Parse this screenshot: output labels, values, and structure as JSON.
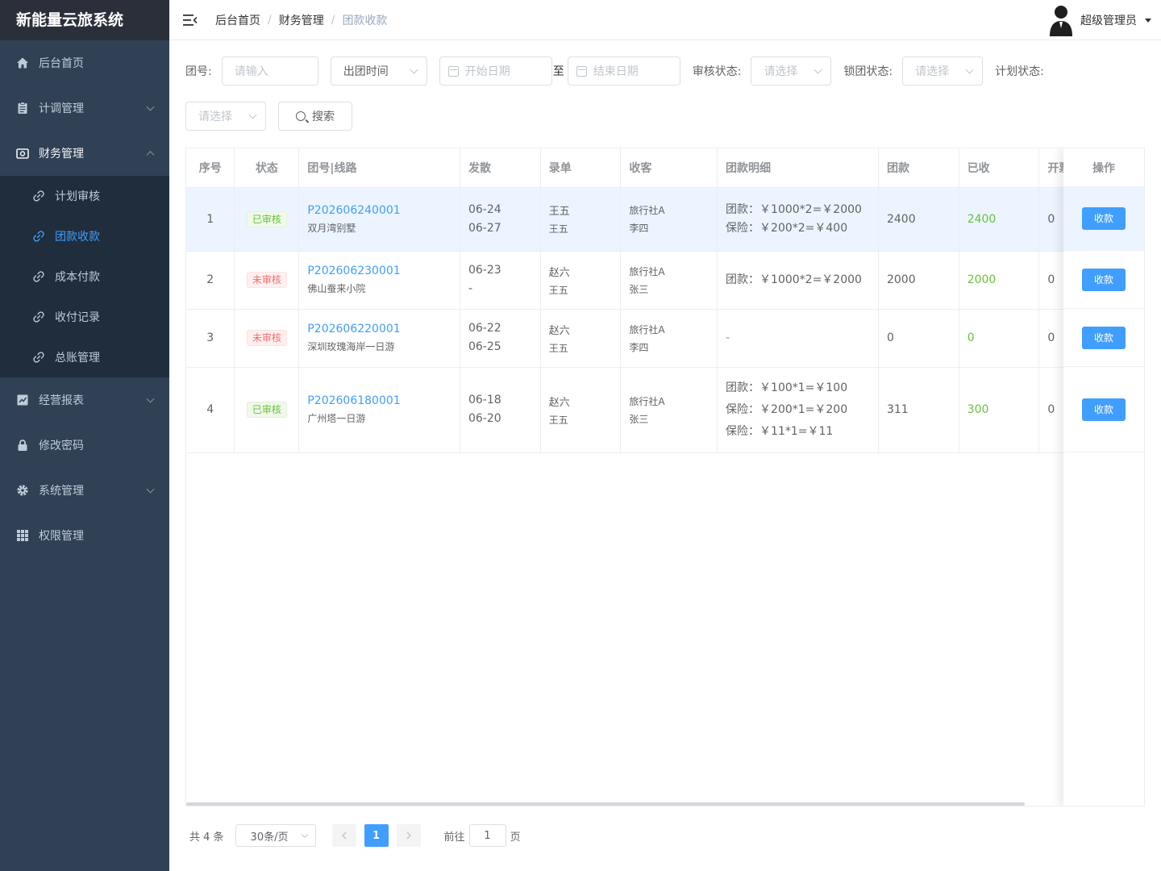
{
  "app": {
    "title": "新能量云旅系统"
  },
  "sidebar": {
    "items": [
      {
        "label": "后台首页",
        "icon": "home-icon"
      },
      {
        "label": "计调管理",
        "icon": "clipboard-icon"
      },
      {
        "label": "财务管理",
        "icon": "wallet-icon"
      },
      {
        "label": "经营报表",
        "icon": "chart-icon"
      },
      {
        "label": "修改密码",
        "icon": "lock-icon"
      },
      {
        "label": "系统管理",
        "icon": "gear-icon"
      },
      {
        "label": "权限管理",
        "icon": "grid-icon"
      }
    ],
    "finance_sub": [
      {
        "label": "计划审核"
      },
      {
        "label": "团款收款"
      },
      {
        "label": "成本付款"
      },
      {
        "label": "收付记录"
      },
      {
        "label": "总账管理"
      }
    ]
  },
  "header": {
    "breadcrumb": [
      "后台首页",
      "财务管理",
      "团款收款"
    ],
    "user_name": "超级管理员"
  },
  "filters": {
    "group_no_label": "团号:",
    "group_no_placeholder": "请输入",
    "date_type": "出团时间",
    "start_placeholder": "开始日期",
    "range_sep": "至",
    "end_placeholder": "结束日期",
    "audit_label": "审核状态:",
    "audit_placeholder": "请选择",
    "lock_label": "锁团状态:",
    "lock_placeholder": "请选择",
    "plan_label": "计划状态:",
    "plan_placeholder": "请选择",
    "search_label": "搜索"
  },
  "table": {
    "headers": [
      "序号",
      "状态",
      "团号|线路",
      "发散",
      "录单",
      "收客",
      "团款明细",
      "团款",
      "已收",
      "开票"
    ],
    "op_header": "操作",
    "op_button": "收款",
    "rows": [
      {
        "no": "1",
        "status": "已审核",
        "status_ok": true,
        "group_no": "P202606240001",
        "route": "双月湾别墅",
        "date1": "06-24",
        "date2": "06-27",
        "entry1": "王五",
        "entry2": "王五",
        "client1": "旅行社A",
        "client2": "李四",
        "details": [
          "团款：￥1000*2=￥2000",
          "保险：￥200*2=￥400"
        ],
        "amount": "2400",
        "received": "2400",
        "invoice": "0"
      },
      {
        "no": "2",
        "status": "未审核",
        "status_ok": false,
        "group_no": "P202606230001",
        "route": "佛山蚕来小院",
        "date1": "06-23",
        "date2": "-",
        "entry1": "赵六",
        "entry2": "王五",
        "client1": "旅行社A",
        "client2": "张三",
        "details": [
          "团款：￥1000*2=￥2000"
        ],
        "amount": "2000",
        "received": "2000",
        "invoice": "0"
      },
      {
        "no": "3",
        "status": "未审核",
        "status_ok": false,
        "group_no": "P202606220001",
        "route": "深圳玫瑰海岸一日游",
        "date1": "06-22",
        "date2": "06-25",
        "entry1": "赵六",
        "entry2": "王五",
        "client1": "旅行社A",
        "client2": "李四",
        "details": [
          "-"
        ],
        "amount": "0",
        "received": "0",
        "invoice": "0"
      },
      {
        "no": "4",
        "status": "已审核",
        "status_ok": true,
        "group_no": "P202606180001",
        "route": "广州塔一日游",
        "date1": "06-18",
        "date2": "06-20",
        "entry1": "赵六",
        "entry2": "王五",
        "client1": "旅行社A",
        "client2": "张三",
        "details": [
          "团款：￥100*1=￥100",
          "保险：￥200*1=￥200",
          "保险：￥11*1=￥11"
        ],
        "amount": "311",
        "received": "300",
        "invoice": "0"
      }
    ]
  },
  "pagination": {
    "total": "共 4 条",
    "page_size": "30条/页",
    "current": "1",
    "goto_label": "前往",
    "goto_value": "1",
    "page_unit": "页"
  }
}
